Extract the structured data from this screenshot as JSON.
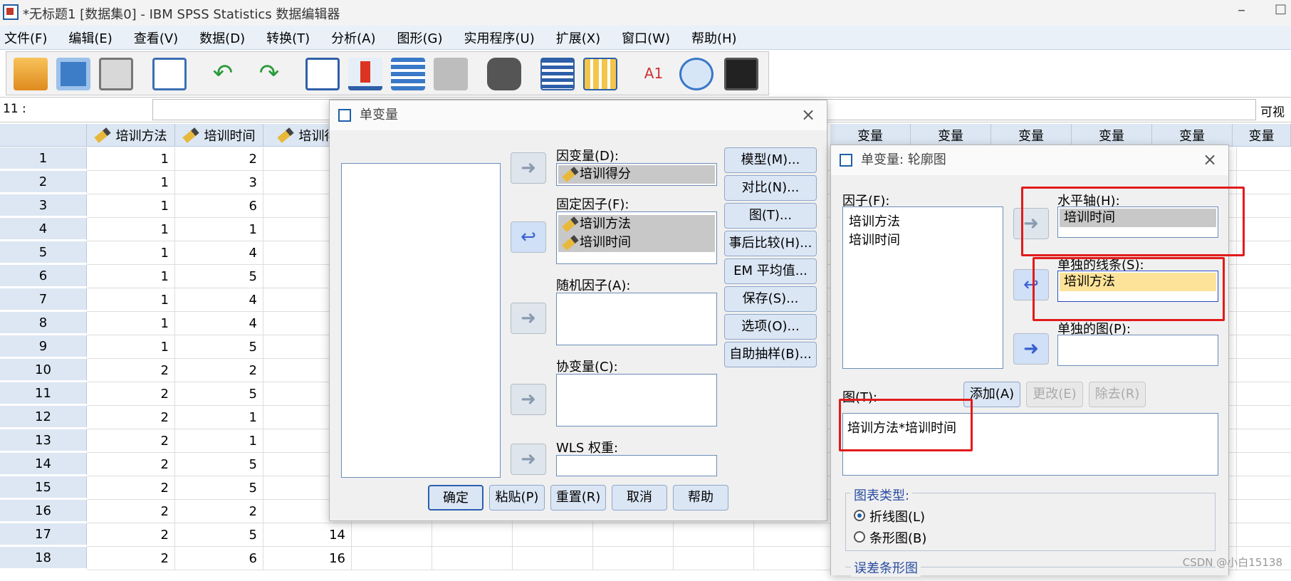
{
  "window": {
    "title": "*无标题1 [数据集0] - IBM SPSS Statistics 数据编辑器",
    "minimize": "–",
    "maximize": "□"
  },
  "menu": [
    "文件(F)",
    "编辑(E)",
    "查看(V)",
    "数据(D)",
    "转换(T)",
    "分析(A)",
    "图形(G)",
    "实用程序(U)",
    "扩展(X)",
    "窗口(W)",
    "帮助(H)"
  ],
  "toolbar_icons": [
    "open-folder-icon",
    "save-icon",
    "print-icon",
    "recall-dialog-icon",
    "undo-icon",
    "redo-icon",
    "goto-case-icon",
    "goto-variable-icon",
    "variables-icon",
    "run-descriptives-icon",
    "find-icon",
    "insert-cases-icon",
    "insert-variable-icon",
    "split-file-icon",
    "weight-cases-icon",
    "select-cases-icon",
    "value-labels-icon",
    "use-variable-sets-icon",
    "show-all-variables-icon"
  ],
  "cellbar": {
    "ref": "11 :",
    "visible": "可视"
  },
  "grid": {
    "headers": [
      "培训方法",
      "培训时间",
      "培训得"
    ],
    "empty_header": "变量",
    "rows": [
      [
        1,
        1,
        2,
        ""
      ],
      [
        2,
        1,
        3,
        ""
      ],
      [
        3,
        1,
        6,
        ""
      ],
      [
        4,
        1,
        1,
        ""
      ],
      [
        5,
        1,
        4,
        ""
      ],
      [
        6,
        1,
        5,
        ""
      ],
      [
        7,
        1,
        4,
        ""
      ],
      [
        8,
        1,
        4,
        ""
      ],
      [
        9,
        1,
        5,
        ""
      ],
      [
        10,
        2,
        2,
        ""
      ],
      [
        11,
        2,
        5,
        ""
      ],
      [
        12,
        2,
        1,
        ""
      ],
      [
        13,
        2,
        1,
        ""
      ],
      [
        14,
        2,
        5,
        ""
      ],
      [
        15,
        2,
        5,
        ""
      ],
      [
        16,
        2,
        2,
        ""
      ],
      [
        17,
        2,
        5,
        14
      ],
      [
        18,
        2,
        6,
        16
      ]
    ]
  },
  "univariate": {
    "title": "单变量",
    "close": "×",
    "dependent_label": "因变量(D):",
    "dependent_value": "培训得分",
    "fixed_label": "固定因子(F):",
    "fixed_values": [
      "培训方法",
      "培训时间"
    ],
    "random_label": "随机因子(A):",
    "covariate_label": "协变量(C):",
    "wls_label": "WLS 权重:",
    "side_buttons": [
      "模型(M)...",
      "对比(N)...",
      "图(T)...",
      "事后比较(H)...",
      "EM 平均值...",
      "保存(S)...",
      "选项(O)...",
      "自助抽样(B)..."
    ],
    "bottom_buttons": [
      "确定",
      "粘贴(P)",
      "重置(R)",
      "取消",
      "帮助"
    ]
  },
  "profile": {
    "title": "单变量: 轮廓图",
    "close": "×",
    "factors_label": "因子(F):",
    "factors": [
      "培训方法",
      "培训时间"
    ],
    "horizontal_label": "水平轴(H):",
    "horizontal_value": "培训时间",
    "separate_lines_label": "单独的线条(S):",
    "separate_lines_value": "培训方法",
    "separate_plots_label": "单独的图(P):",
    "plots_label": "图(T):",
    "add_label": "添加(A)",
    "change_label": "更改(E)",
    "remove_label": "除去(R)",
    "plots_value": "培训方法*培训时间",
    "chart_type_label": "图表类型:",
    "line_label": "折线图(L)",
    "bar_label": "条形图(B)",
    "error_bars_label": "误差条形图"
  },
  "watermark": "CSDN @小白15138"
}
